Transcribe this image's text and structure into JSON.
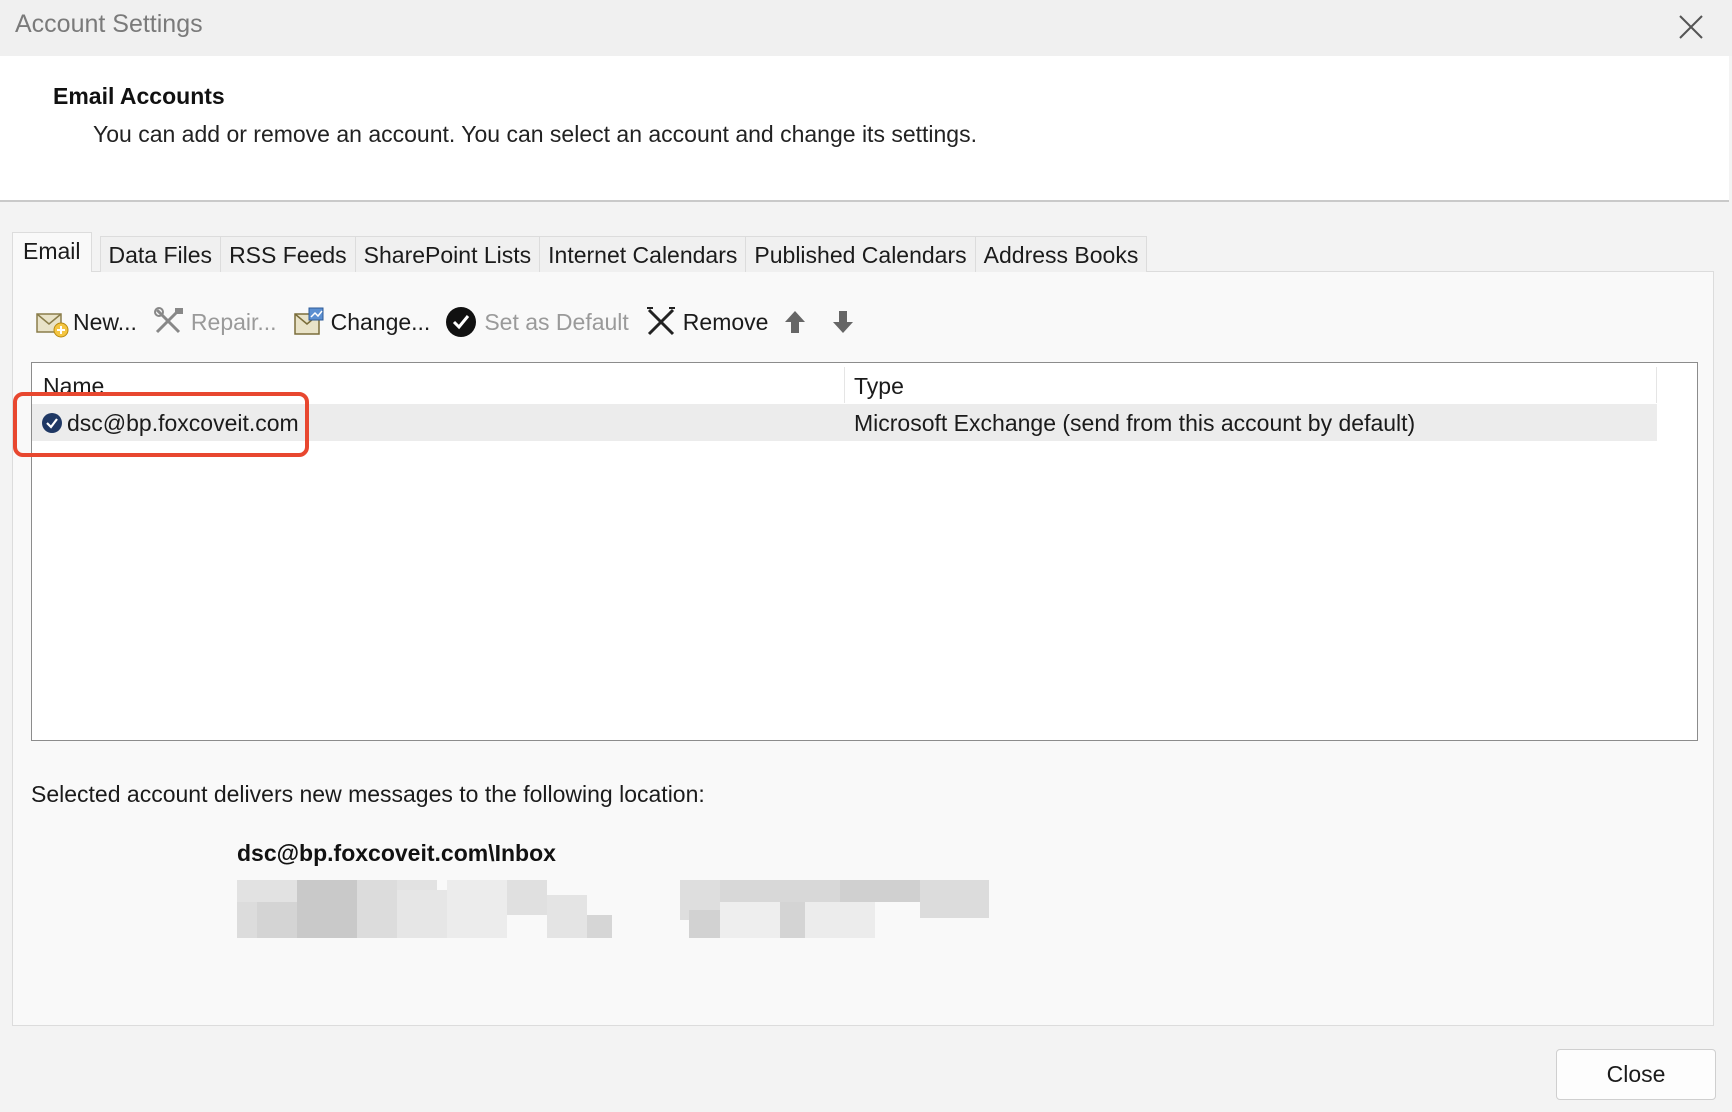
{
  "window": {
    "title": "Account Settings"
  },
  "header": {
    "title": "Email Accounts",
    "subtitle": "You can add or remove an account. You can select an account and change its settings."
  },
  "tabs": [
    {
      "label": "Email",
      "active": true
    },
    {
      "label": "Data Files"
    },
    {
      "label": "RSS Feeds"
    },
    {
      "label": "SharePoint Lists"
    },
    {
      "label": "Internet Calendars"
    },
    {
      "label": "Published Calendars"
    },
    {
      "label": "Address Books"
    }
  ],
  "toolbar": {
    "new_label": "New...",
    "repair_label": "Repair...",
    "change_label": "Change...",
    "set_default_label": "Set as Default",
    "remove_label": "Remove"
  },
  "list": {
    "columns": {
      "name": "Name",
      "type": "Type"
    },
    "rows": [
      {
        "name": "dsc@bp.foxcoveit.com",
        "type": "Microsoft Exchange (send from this account by default)"
      }
    ]
  },
  "delivery": {
    "label": "Selected account delivers new messages to the following location:",
    "path": "dsc@bp.foxcoveit.com\\Inbox"
  },
  "footer": {
    "close_label": "Close"
  },
  "colors": {
    "highlight": "#e8472f",
    "accent": "#1f3864"
  }
}
